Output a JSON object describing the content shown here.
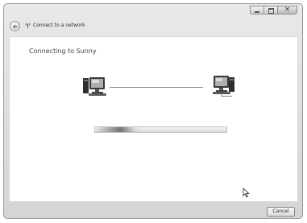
{
  "window": {
    "title": "Connect to a network",
    "close_glyph": "×",
    "caption_buttons": [
      "minimize-icon",
      "maximize-icon",
      "close-icon"
    ]
  },
  "main": {
    "status": "Connecting to Sunny",
    "progress": {
      "state": "indeterminate"
    },
    "icons": [
      "computer-icon",
      "network-computer-icon"
    ]
  },
  "footer": {
    "cancel_label": "Cancel"
  },
  "colors": {
    "chrome": "#d4d4d4",
    "content_bg": "#ffffff",
    "text": "#444444"
  }
}
